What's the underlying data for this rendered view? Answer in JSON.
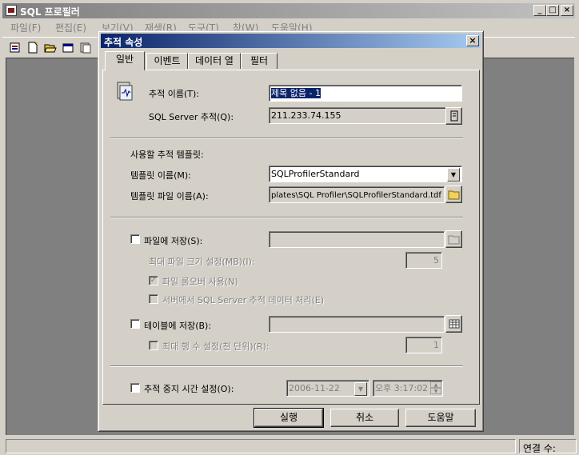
{
  "app": {
    "title": "SQL 프로필러",
    "window_controls": [
      "_",
      "□",
      "×"
    ],
    "menu": [
      "파일(F)",
      "편집(E)",
      "보기(V)",
      "재생(R)",
      "도구(T)",
      "창(W)",
      "도움말(H)"
    ],
    "toolbar_icons": [
      "new-trace-icon",
      "new-template-icon",
      "open-icon",
      "properties-icon",
      "template-icon"
    ],
    "status": "연결 수: "
  },
  "dialog": {
    "title": "추적 속성",
    "close": "×",
    "tabs": [
      "일반",
      "이벤트",
      "데이터 열",
      "필터"
    ],
    "trace_name_label": "추적 이름(T):",
    "trace_name_value": "제목 없음 - 1",
    "sql_server_label": "SQL Server 추적(Q):",
    "sql_server_value": "211.233.74.155",
    "template_section_label": "사용할 추적 템플릿:",
    "template_name_label": "템플릿 이름(M):",
    "template_name_value": "SQLProfilerStandard",
    "template_file_label": "템플릿 파일 이름(A):",
    "template_file_value": "plates\\SQL Profiler\\SQLProfilerStandard.tdf",
    "save_to_file_label": "파일에 저장(S):",
    "max_file_size_label": "최대 파일 크기 설정(MB)(I):",
    "max_file_size_value": "5",
    "file_rollover_label": "파일 롤오버 사용(N)",
    "server_process_label": "서버에서 SQL Server 추적 데이터 처리(E)",
    "save_to_table_label": "테이블에 저장(B):",
    "max_rows_label": "최대 행 수 설정(천 단위)(R):",
    "max_rows_value": "1",
    "stop_time_label": "추적 중지 시간 설정(O):",
    "stop_date_value": "2006-11-22",
    "stop_time_value": "오후   3:17:02",
    "buttons": {
      "run": "실행",
      "cancel": "취소",
      "help": "도움말"
    }
  }
}
